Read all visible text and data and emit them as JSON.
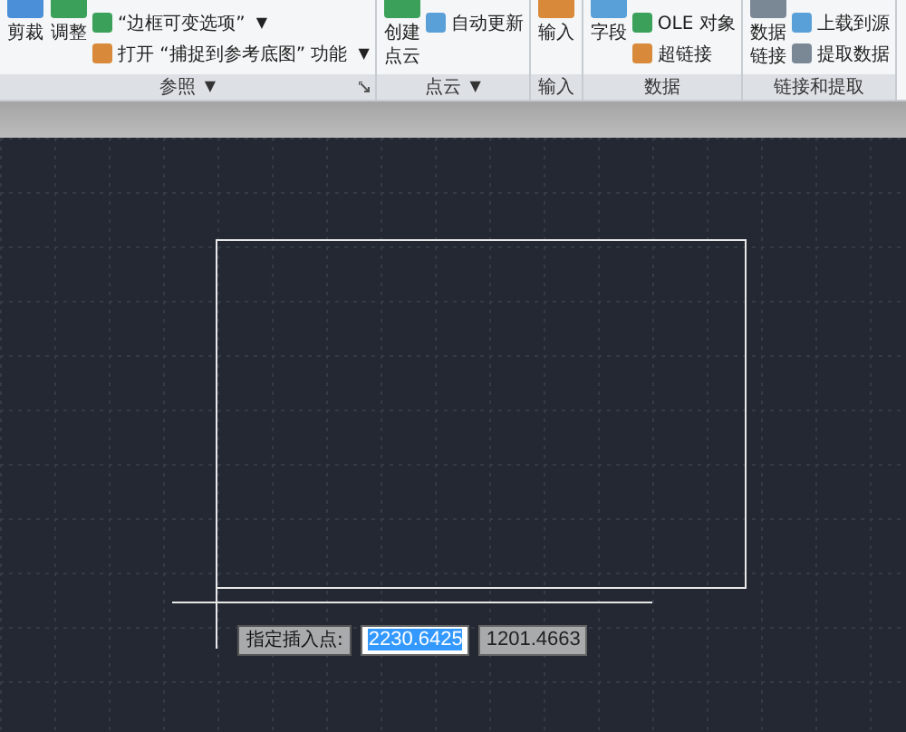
{
  "ribbon": {
    "panels": [
      {
        "title": "参照",
        "menu_arrow": "▼",
        "has_launcher": true,
        "large": [
          {
            "label": "剪裁"
          },
          {
            "label": "调整"
          }
        ],
        "small": [
          {
            "label": "“边框可变选项”",
            "arrow": "▼"
          },
          {
            "label": "打开 “捕捉到参考底图” 功能",
            "arrow": "▼"
          }
        ]
      },
      {
        "title": "点云",
        "menu_arrow": "▼",
        "large": [
          {
            "label": "创建点云"
          }
        ],
        "small": [
          {
            "label": "自动更新"
          }
        ]
      },
      {
        "title": "输入",
        "large": [
          {
            "label": "输入"
          }
        ]
      },
      {
        "title": "数据",
        "large": [
          {
            "label": "字段"
          }
        ],
        "small": [
          {
            "label": "OLE 对象"
          },
          {
            "label": "超链接"
          }
        ]
      },
      {
        "title": "链接和提取",
        "large": [
          {
            "label": "数据链接"
          }
        ],
        "small": [
          {
            "label": "上载到源"
          },
          {
            "label": "提取数据"
          }
        ]
      }
    ]
  },
  "command_prompt": {
    "label": "指定插入点:",
    "fields": [
      {
        "value": "2230.6425",
        "selected": true
      },
      {
        "value": "1201.4663",
        "selected": false
      }
    ]
  }
}
